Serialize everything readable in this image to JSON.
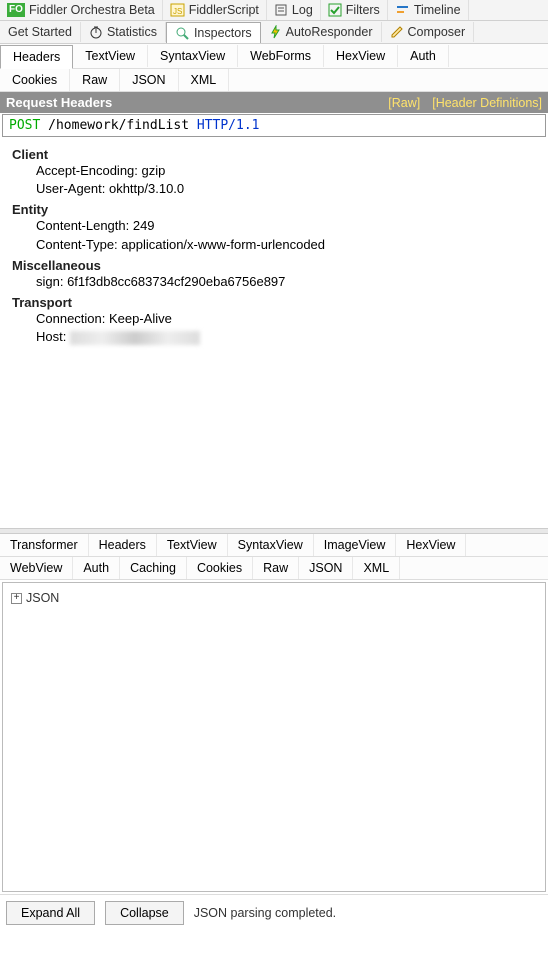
{
  "topTabs": {
    "orchestra": "Fiddler Orchestra Beta",
    "fiddlerScript": "FiddlerScript",
    "log": "Log",
    "filters": "Filters",
    "timeline": "Timeline"
  },
  "mainTabs": {
    "getStarted": "Get Started",
    "statistics": "Statistics",
    "inspectors": "Inspectors",
    "autoResponder": "AutoResponder",
    "composer": "Composer"
  },
  "reqTabs": {
    "headers": "Headers",
    "textView": "TextView",
    "syntaxView": "SyntaxView",
    "webForms": "WebForms",
    "hexView": "HexView",
    "auth": "Auth",
    "cookies": "Cookies",
    "raw": "Raw",
    "json": "JSON",
    "xml": "XML"
  },
  "requestHeadersBar": {
    "title": "Request Headers",
    "rawLink": "[Raw]",
    "defsLink": "[Header Definitions]"
  },
  "requestLine": {
    "method": "POST",
    "path": "/homework/findList",
    "protocol": "HTTP/1.1"
  },
  "headers": {
    "client": {
      "title": "Client",
      "acceptEncoding": "Accept-Encoding: gzip",
      "userAgent": "User-Agent: okhttp/3.10.0"
    },
    "entity": {
      "title": "Entity",
      "contentLength": "Content-Length: 249",
      "contentType": "Content-Type: application/x-www-form-urlencoded"
    },
    "misc": {
      "title": "Miscellaneous",
      "sign": "sign: 6f1f3db8cc683734cf290eba6756e897"
    },
    "transport": {
      "title": "Transport",
      "connection": "Connection: Keep-Alive",
      "hostLabel": "Host:"
    }
  },
  "resTabs": {
    "transformer": "Transformer",
    "headers": "Headers",
    "textView": "TextView",
    "syntaxView": "SyntaxView",
    "imageView": "ImageView",
    "hexView": "HexView",
    "webView": "WebView",
    "auth": "Auth",
    "caching": "Caching",
    "cookies": "Cookies",
    "raw": "Raw",
    "json": "JSON",
    "xml": "XML"
  },
  "jsonTree": {
    "root": "JSON"
  },
  "bottom": {
    "expandAll": "Expand All",
    "collapse": "Collapse",
    "status": "JSON parsing completed."
  }
}
